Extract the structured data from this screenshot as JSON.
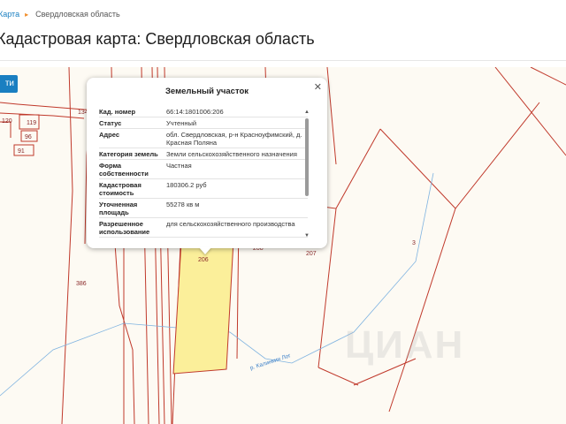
{
  "breadcrumb": {
    "link": "Карта",
    "separator": "▸",
    "current": "Свердловская область"
  },
  "page_title": "Кадастровая карта: Свердловская область",
  "map_button_label": "ти",
  "map_labels": {
    "plot_206": "206",
    "plot_208": "208",
    "plot_207": "207",
    "plot_3": "3",
    "plot_386": "386",
    "plot_119": "119",
    "plot_96": "96",
    "plot_91": "91",
    "plot_120": "120",
    "plot_134": "134",
    "stream": "р. Калинкин Лог"
  },
  "watermark": "ЦИАН",
  "popup": {
    "title": "Земельный участок",
    "close_icon": "close-icon",
    "rows": [
      {
        "label": "Кад. номер",
        "value": "66:14:1801006:206"
      },
      {
        "label": "Статус",
        "value": "Учтенный"
      },
      {
        "label": "Адрес",
        "value": "обл. Свердловская, р-н Красноуфимский, д. Красная Поляна"
      },
      {
        "label": "Категория земель",
        "value": "Земли сельскохозяйственного назначения"
      },
      {
        "label": "Форма собственности",
        "value": "Частная"
      },
      {
        "label": "Кадастровая стоимость",
        "value": "180306.2 руб"
      },
      {
        "label": "Уточненная площадь",
        "value": "55278 кв м"
      },
      {
        "label": "Разрешенное использование",
        "value": "для сельскохозяйственного производства"
      }
    ]
  },
  "colors": {
    "parcel_line": "#c0392b",
    "selected_parcel_fill": "#fbef9a",
    "map_background": "#fdfaf3",
    "stream": "#7fb3e0",
    "accent": "#1a7fc1"
  }
}
